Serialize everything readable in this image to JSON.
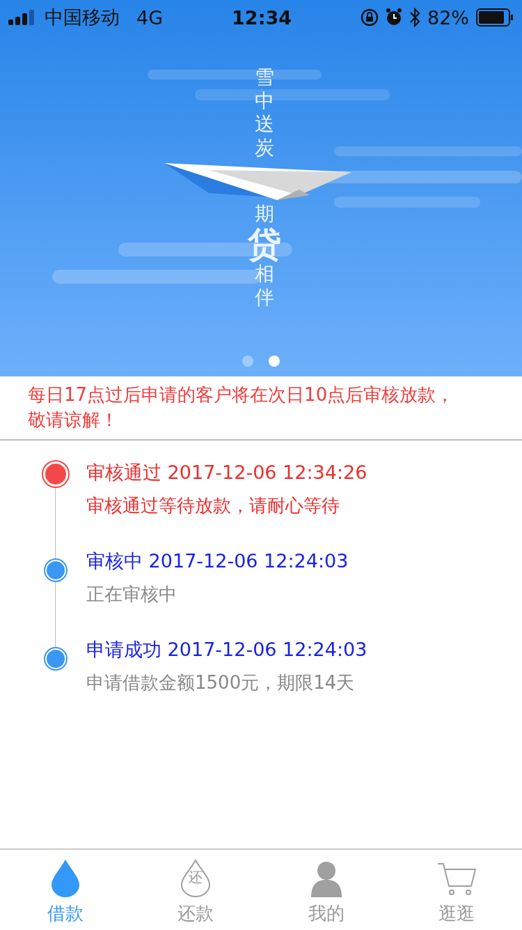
{
  "status_bar": {
    "carrier": "中国移动",
    "network": "4G",
    "time": "12:34",
    "battery": "82%"
  },
  "banner": {
    "slogan_top": "雪中送炭",
    "slogan_bottom": "期**贷**相伴",
    "dots": [
      {
        "selected": false
      },
      {
        "selected": true
      }
    ]
  },
  "notice": "每日17点过后申请的客户将在次日10点后审核放款，敬请谅解！",
  "timeline": [
    {
      "kind": "current",
      "title": "审核通过",
      "time": "2017-12-06 12:34:26",
      "desc": "审核通过等待放款，请耐心等待"
    },
    {
      "kind": "past",
      "title": "审核中",
      "time": "2017-12-06 12:24:03",
      "desc": "正在审核中"
    },
    {
      "kind": "past",
      "title": "申请成功",
      "time": "2017-12-06 12:24:03",
      "desc": "申请借款金额1500元，期限14天"
    }
  ],
  "tab_bar": [
    {
      "kind": "drop",
      "label": "借款",
      "selected": true
    },
    {
      "kind": "repay",
      "label": "还款",
      "icon_text": "还",
      "selected": false
    },
    {
      "kind": "person",
      "label": "我的",
      "selected": false
    },
    {
      "kind": "cart",
      "label": "逛逛",
      "selected": false
    }
  ]
}
